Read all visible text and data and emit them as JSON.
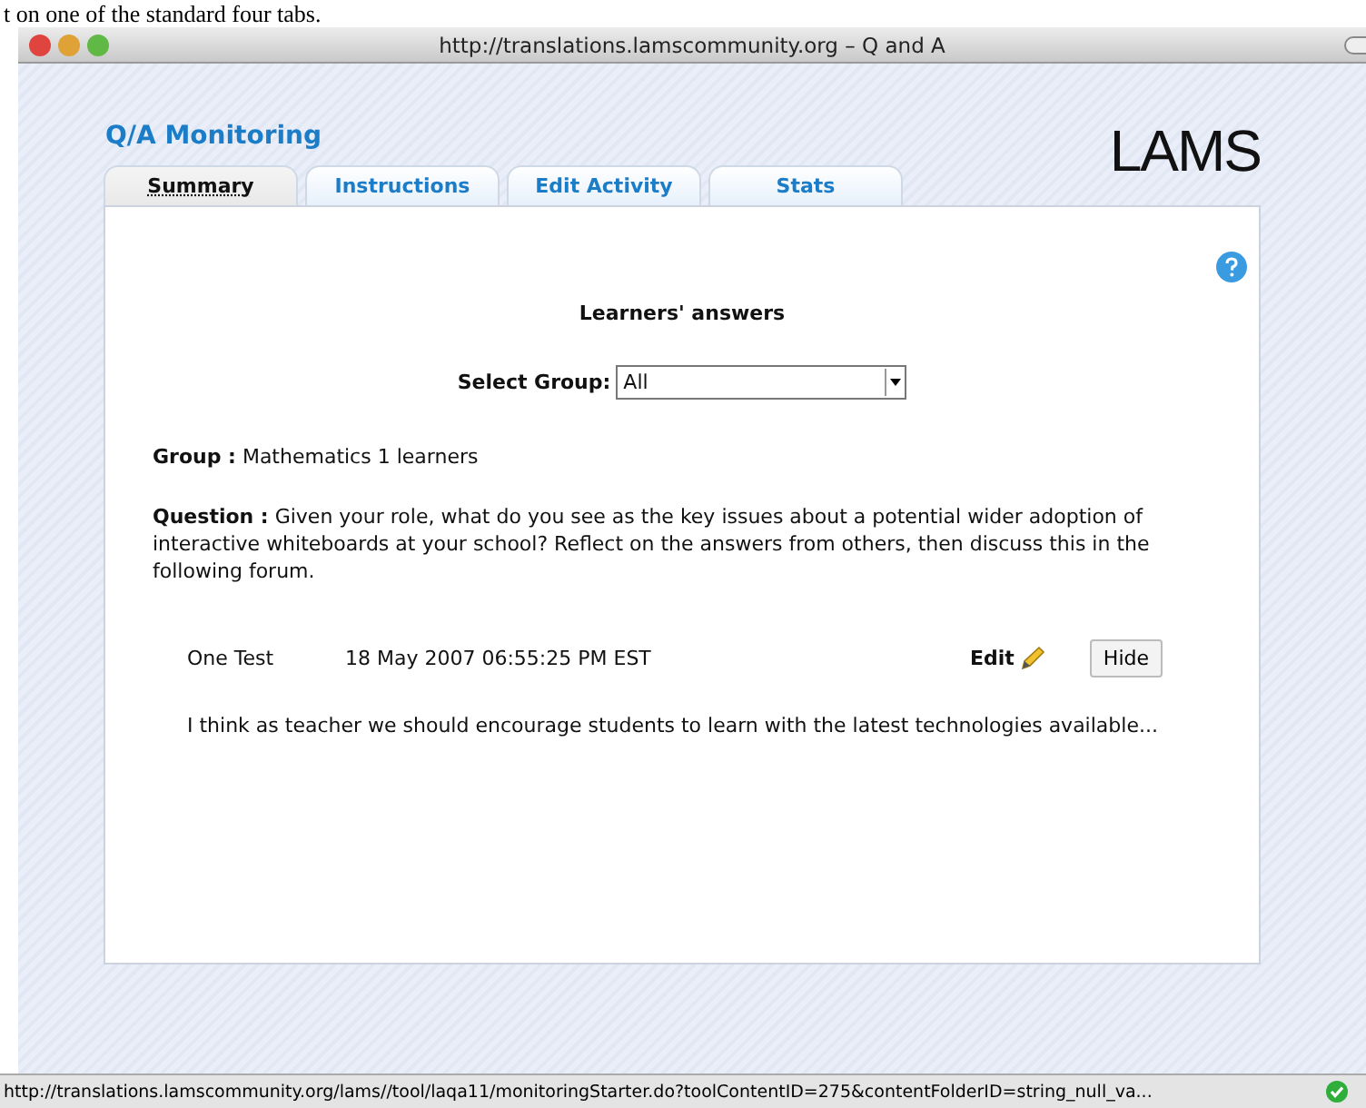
{
  "caption": "t on one of the standard four tabs.",
  "window": {
    "title": "http://translations.lamscommunity.org – Q and A"
  },
  "page_title": "Q/A Monitoring",
  "logo": "LAMS",
  "tabs": [
    {
      "label": "Summary",
      "selected": true
    },
    {
      "label": "Instructions",
      "selected": false
    },
    {
      "label": "Edit Activity",
      "selected": false
    },
    {
      "label": "Stats",
      "selected": false
    }
  ],
  "heading": "Learners' answers",
  "select_group": {
    "label": "Select Group:",
    "value": "All"
  },
  "group": {
    "label": "Group :",
    "value": "Mathematics 1 learners"
  },
  "question": {
    "label": "Question :",
    "text": "Given your role, what do you see as the key issues about a potential wider adoption of interactive whiteboards at your school? Reflect on the answers from others, then discuss this in the following forum."
  },
  "answers": [
    {
      "learner": "One Test",
      "date": "18 May 2007 06:55:25 PM EST",
      "edit": "Edit",
      "hide": "Hide",
      "text": "I think as teacher we should encourage students to learn with the latest technologies available..."
    }
  ],
  "status_bar": {
    "url": "http://translations.lamscommunity.org/lams//tool/laqa11/monitoringStarter.do?toolContentID=275&contentFolderID=string_null_va..."
  }
}
